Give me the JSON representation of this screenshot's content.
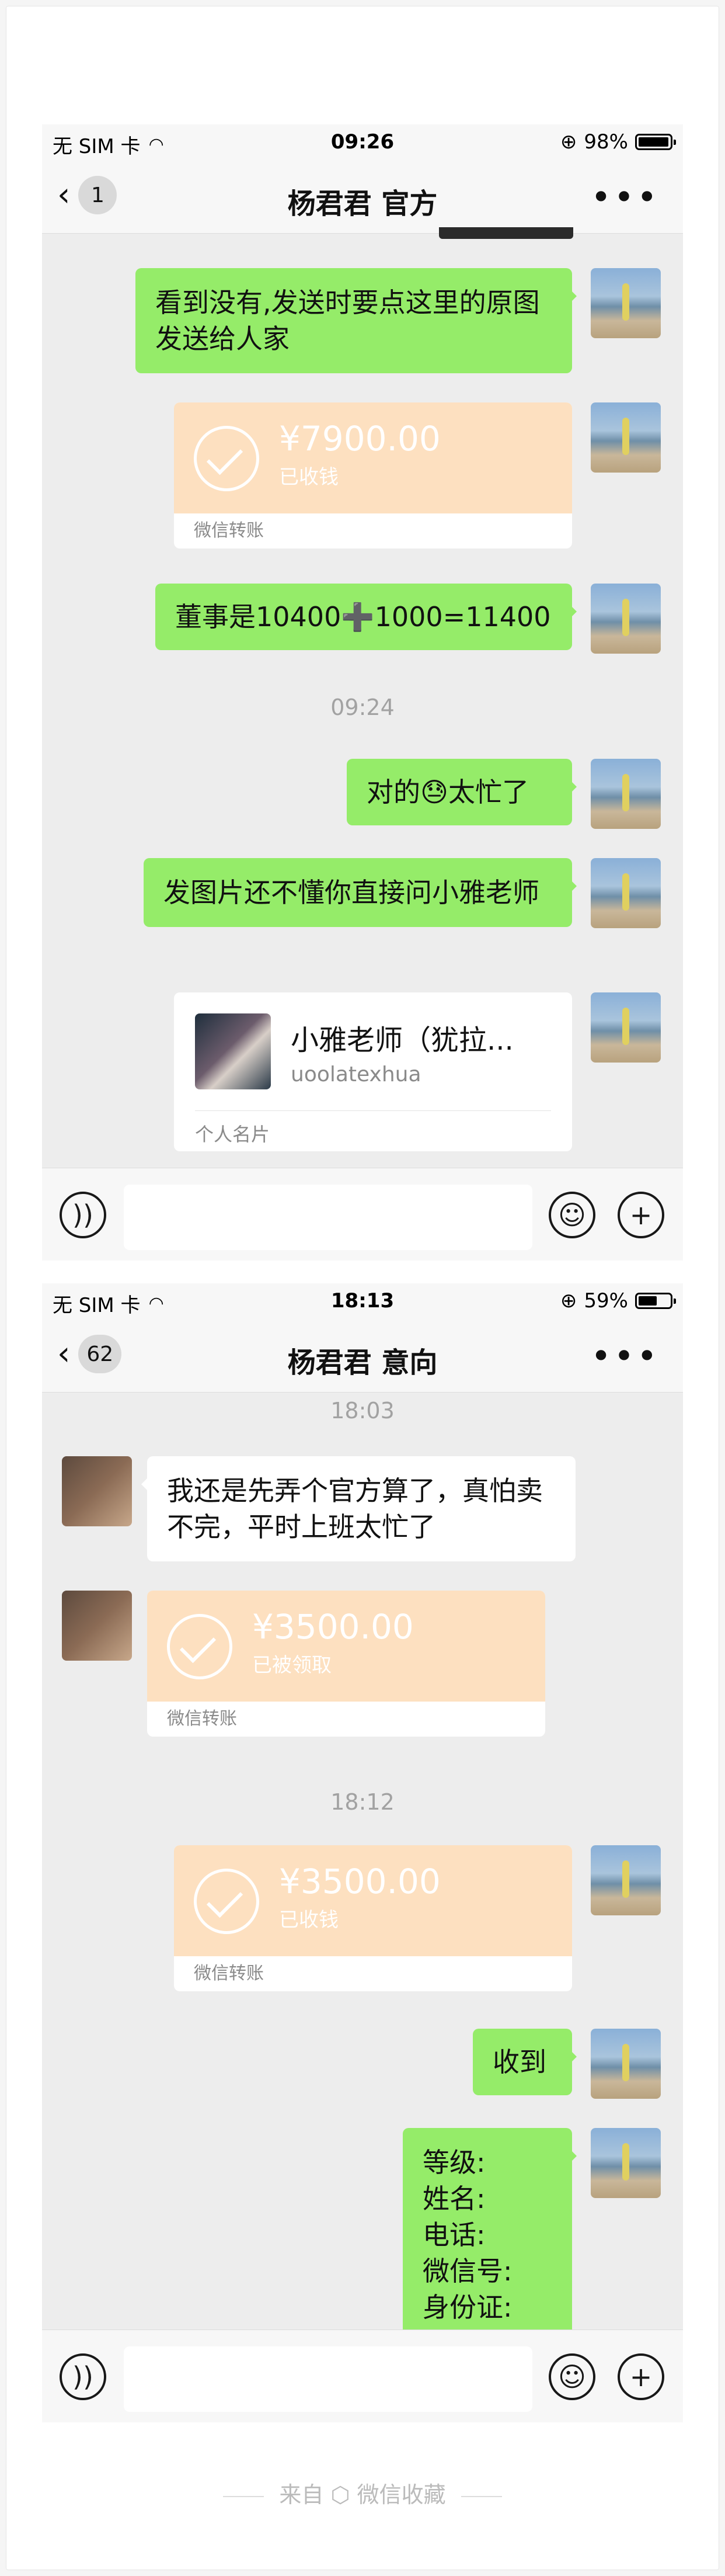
{
  "screen1": {
    "status": {
      "carrier": "无 SIM 卡",
      "time": "09:26",
      "battery": "98%",
      "battery_level": 0.98
    },
    "nav": {
      "back_count": "1",
      "title": "杨君君 官方",
      "more": "•••"
    },
    "messages": {
      "m1": "看到没有,发送时要点这里的原图发送给人家",
      "t1_amount": "¥7900.00",
      "t1_status": "已收钱",
      "t1_foot": "微信转账",
      "m2": "董事是10400➕1000=11400",
      "time1": "09:24",
      "m3": "对的😓太忙了",
      "m4": "发图片还不懂你直接问小雅老师",
      "card_name": "小雅老师（犹拉...",
      "card_id": "uoolatexhua",
      "card_foot": "个人名片"
    }
  },
  "screen2": {
    "status": {
      "carrier": "无 SIM 卡",
      "time": "18:13",
      "battery": "59%",
      "battery_level": 0.59
    },
    "nav": {
      "back_count": "62",
      "title": "杨君君 意向",
      "more": "•••"
    },
    "messages": {
      "time1": "18:03",
      "m1": "我还是先弄个官方算了，真怕卖不完，平时上班太忙了",
      "t1_amount": "¥3500.00",
      "t1_status": "已被领取",
      "t1_foot": "微信转账",
      "time2": "18:12",
      "t2_amount": "¥3500.00",
      "t2_status": "已收钱",
      "t2_foot": "微信转账",
      "m2": "收到",
      "form": [
        "等级:",
        "姓名:",
        "电话:",
        "微信号:",
        "身份证:"
      ]
    }
  },
  "credit": "来自 ⬡ 微信收藏"
}
